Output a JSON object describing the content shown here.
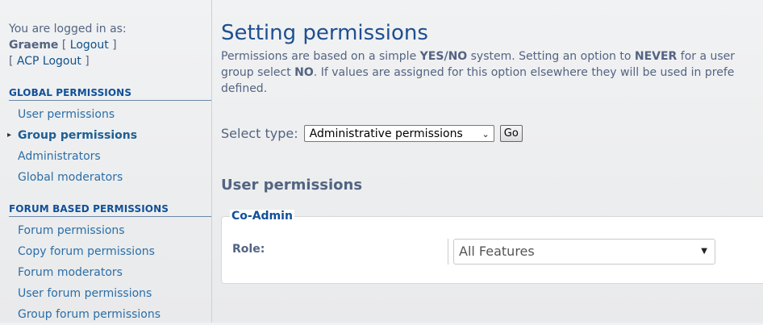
{
  "login": {
    "prefix": "You are logged in as:",
    "username": "Graeme",
    "logout_label": "Logout",
    "acp_logout_label": "ACP Logout"
  },
  "sidebar": {
    "global_heading": "GLOBAL PERMISSIONS",
    "global_items": [
      {
        "label": "User permissions"
      },
      {
        "label": "Group permissions"
      },
      {
        "label": "Administrators"
      },
      {
        "label": "Global moderators"
      }
    ],
    "forum_heading": "FORUM BASED PERMISSIONS",
    "forum_items": [
      {
        "label": "Forum permissions"
      },
      {
        "label": "Copy forum permissions"
      },
      {
        "label": "Forum moderators"
      },
      {
        "label": "User forum permissions"
      },
      {
        "label": "Group forum permissions"
      }
    ]
  },
  "main": {
    "title": "Setting permissions",
    "intro": {
      "t1": "Permissions are based on a simple ",
      "yes": "YES",
      "slash": "/",
      "no": "NO",
      "t2": " system. Setting an option to ",
      "never": "NEVER",
      "t3": " for a user",
      "t4": "group select ",
      "no2": "NO",
      "t5": ". If values are assigned for this option elsewhere they will be used in prefe",
      "t6": "defined."
    },
    "select_type_label": "Select type:",
    "select_type_value": "Administrative permissions",
    "go_label": "Go",
    "section_title": "User permissions",
    "group_legend": "Co-Admin",
    "role_label": "Role:",
    "role_value": "All Features"
  }
}
